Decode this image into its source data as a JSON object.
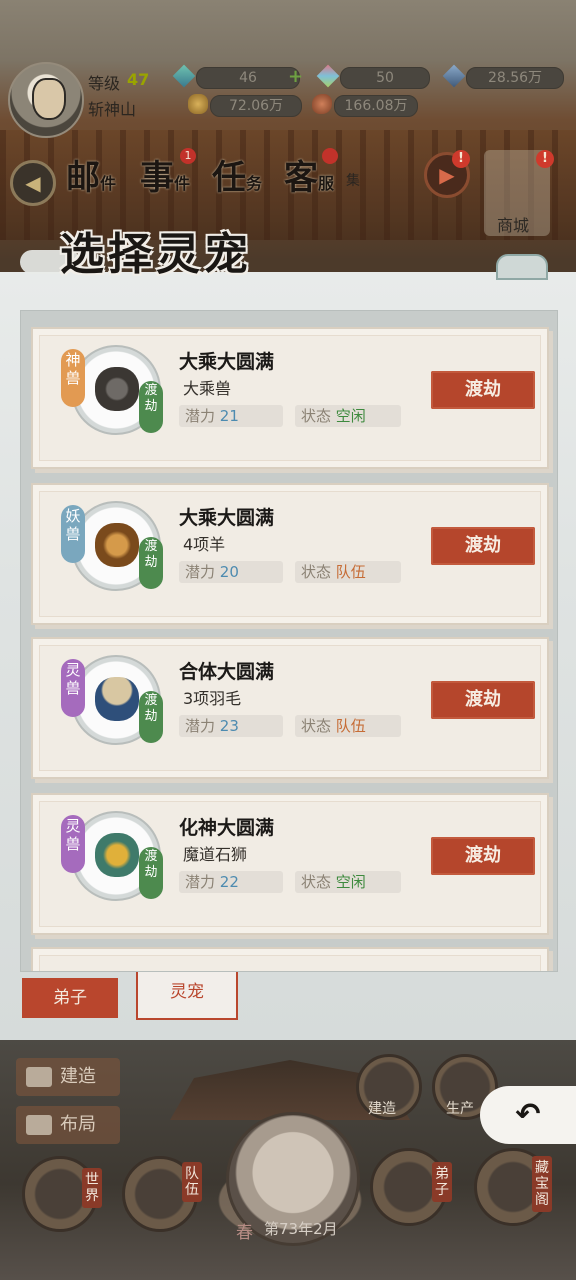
{
  "player": {
    "level_label": "等级",
    "level_value": "47",
    "name": "斩神山"
  },
  "resources": {
    "jade": "46",
    "spirit_stone": "50",
    "crystal": "28.56万",
    "gold": "72.06万",
    "food": "166.08万"
  },
  "top_nav": {
    "mail": "邮",
    "mail_sub": "件",
    "events": "事",
    "events_sub": "件",
    "events_badge": "1",
    "tasks": "任",
    "tasks_sub": "务",
    "service": "客",
    "service_sub": "服",
    "collect_sub": "集",
    "shop_label": "商城",
    "alert": "!"
  },
  "dialog": {
    "title": "选择灵宠",
    "pets": [
      {
        "type_tag": "神兽",
        "realm": "大乘大圆满",
        "name": "大乘兽",
        "potential_label": "潜力",
        "potential": "21",
        "status_label": "状态",
        "status": "空闲",
        "tribulation_tag": "渡劫",
        "action": "渡劫"
      },
      {
        "type_tag": "妖兽",
        "realm": "大乘大圆满",
        "name": "4项羊",
        "potential_label": "潜力",
        "potential": "20",
        "status_label": "状态",
        "status": "队伍",
        "tribulation_tag": "渡劫",
        "action": "渡劫"
      },
      {
        "type_tag": "灵兽",
        "realm": "合体大圆满",
        "name": "3项羽毛",
        "potential_label": "潜力",
        "potential": "23",
        "status_label": "状态",
        "status": "队伍",
        "tribulation_tag": "渡劫",
        "action": "渡劫"
      },
      {
        "type_tag": "灵兽",
        "realm": "化神大圆满",
        "name": "魔道石狮",
        "potential_label": "潜力",
        "potential": "22",
        "status_label": "状态",
        "status": "空闲",
        "tribulation_tag": "渡劫",
        "action": "渡劫"
      }
    ],
    "tabs": {
      "disciple": "弟子",
      "pet": "灵宠"
    }
  },
  "hud": {
    "build": "建造",
    "layout": "布局",
    "build_round": "建造",
    "produce": "生产",
    "world": "世界",
    "team": "队伍",
    "disciple": "弟子",
    "treasury": "藏宝阁",
    "season": "春",
    "date": "第73年2月",
    "back": "↶"
  },
  "colors": {
    "accent_red": "#b5462c",
    "panel_bg": "#e8ebea",
    "card_bg": "#f1ece4",
    "tag_divine": "#e29a52",
    "tag_demon": "#7aa7be",
    "tag_spirit": "#a56bbd",
    "status_idle": "#3e8a3e",
    "status_team": "#c66c36",
    "potential": "#4d8bb0"
  }
}
